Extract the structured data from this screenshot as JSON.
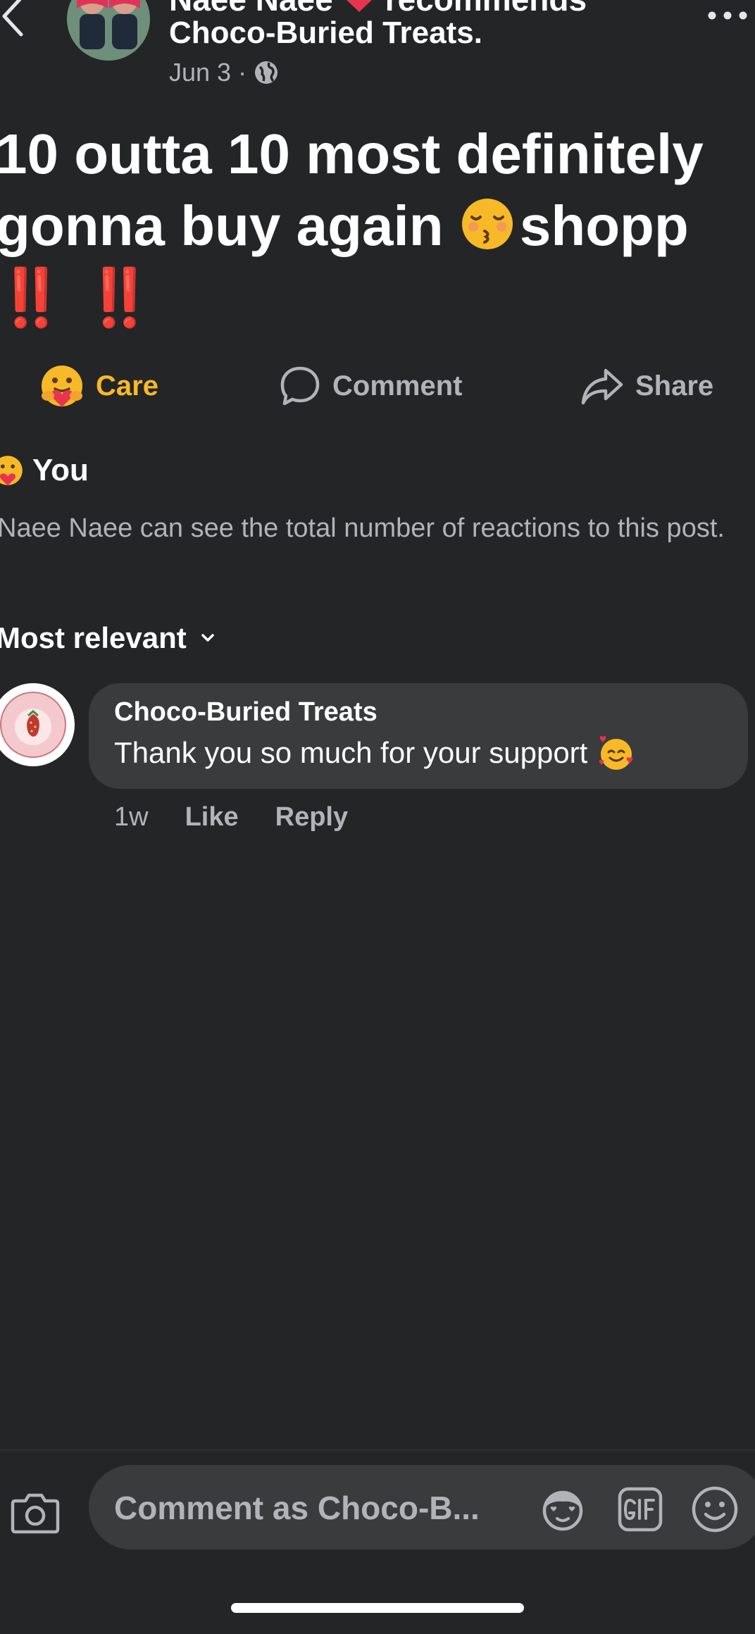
{
  "post": {
    "author_line": "Naee Naee",
    "recommends_text": "recommends",
    "page_name": "Choco-Buried Treats.",
    "date": "Jun 3",
    "date_separator": "·",
    "privacy_icon": "globe-icon",
    "body_line1": "10 outta 10 most definitely",
    "body_line2_start": "gonna buy again",
    "body_line2_end": "shopp",
    "body_line3": "‼️ ‼️",
    "body_emoji": "kissing-face-closed-eyes"
  },
  "actions": {
    "care_label": "Care",
    "comment_label": "Comment",
    "share_label": "Share",
    "care_color": "#f7b928"
  },
  "reactions": {
    "you_label": "You",
    "privacy_note": "Naee Naee can see the total number of reactions to this post."
  },
  "comments": {
    "sort_label": "Most relevant",
    "items": [
      {
        "author": "Choco-Buried Treats",
        "text": "Thank you so much for your support",
        "emoji": "smiling-face-with-hearts",
        "time": "1w",
        "like_label": "Like",
        "reply_label": "Reply"
      }
    ]
  },
  "composer": {
    "placeholder": "Comment as Choco-B..."
  },
  "colors": {
    "background": "#242526",
    "bubble": "#3a3b3c",
    "secondary_text": "#b0b3b8",
    "accent_care": "#f7b928",
    "exclamation": "#e0241b"
  }
}
